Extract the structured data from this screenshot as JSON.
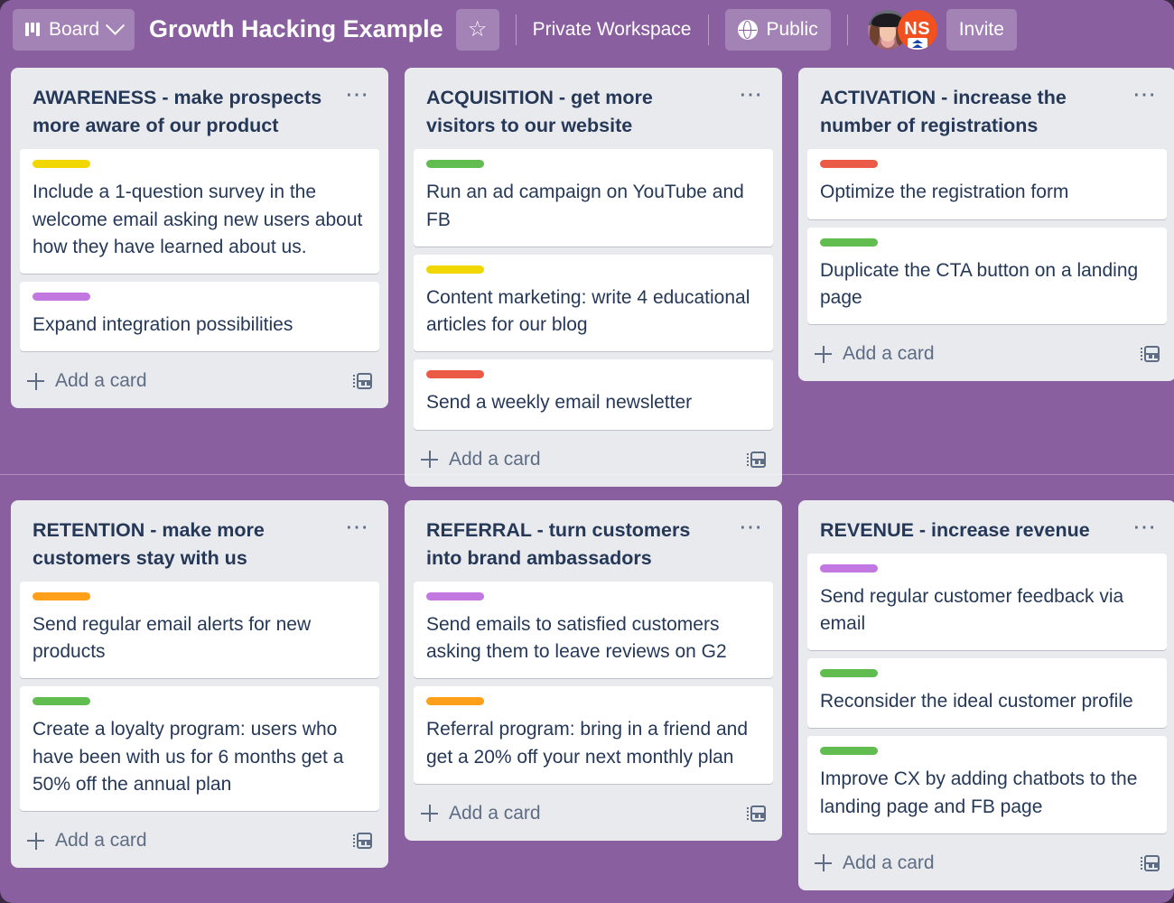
{
  "header": {
    "view_button_label": "Board",
    "view_icon": "board-icon",
    "chevron_icon": "chevron-down-icon",
    "board_title": "Growth Hacking Example",
    "star_icon": "star-icon",
    "workspace_label": "Private Workspace",
    "visibility_label": "Public",
    "visibility_icon": "globe-icon",
    "members": [
      {
        "type": "photo",
        "name": "member-avatar-photo"
      },
      {
        "type": "initials",
        "initials": "NS",
        "name": "member-avatar-initials"
      }
    ],
    "invite_label": "Invite"
  },
  "board": {
    "add_card_label": "Add a card",
    "card_template_icon": "card-template-icon",
    "list_menu_icon": "list-actions-icon",
    "label_colors": {
      "yellow": "#f2d600",
      "purple": "#c377e0",
      "green": "#61bd4f",
      "red": "#eb5a46",
      "orange": "#ff9f1a"
    },
    "rows": [
      {
        "lists": [
          {
            "title": "AWARENESS - make prospects more aware of our product",
            "cards": [
              {
                "label": "yellow",
                "title": "Include a 1-question survey in the welcome email asking new users about how they have learned about us."
              },
              {
                "label": "purple",
                "title": "Expand integration possibilities"
              }
            ]
          },
          {
            "title": "ACQUISITION - get more visitors to our website",
            "cards": [
              {
                "label": "green",
                "title": "Run an ad campaign on YouTube and FB"
              },
              {
                "label": "yellow",
                "title": "Content marketing: write 4 educational articles for our blog"
              },
              {
                "label": "red",
                "title": "Send a weekly email newsletter"
              }
            ]
          },
          {
            "title": "ACTIVATION - increase the number of registrations",
            "cards": [
              {
                "label": "red",
                "title": "Optimize the registration form"
              },
              {
                "label": "green",
                "title": "Duplicate the CTA button on a landing page"
              }
            ]
          }
        ]
      },
      {
        "lists": [
          {
            "title": "RETENTION - make more customers stay with us",
            "cards": [
              {
                "label": "orange",
                "title": "Send regular email alerts for new products"
              },
              {
                "label": "green",
                "title": "Create a loyalty program: users who have been with us for 6 months get a 50% off the annual plan"
              }
            ]
          },
          {
            "title": "REFERRAL - turn customers into brand ambassadors",
            "cards": [
              {
                "label": "purple",
                "title": "Send emails to satisfied customers asking them to leave reviews on G2"
              },
              {
                "label": "orange",
                "title": "Referral program: bring in a friend and get a 20% off your next monthly plan"
              }
            ]
          },
          {
            "title": "REVENUE - increase revenue",
            "cards": [
              {
                "label": "purple",
                "title": "Send regular customer feedback via email"
              },
              {
                "label": "green",
                "title": "Reconsider the ideal customer profile"
              },
              {
                "label": "green",
                "title": "Improve CX by adding chatbots to the landing page and FB page"
              }
            ]
          }
        ]
      }
    ]
  },
  "theme": {
    "background": "#8a5fa0",
    "list_background": "#e9eaee",
    "card_background": "#ffffff",
    "text_dark": "#253858",
    "text_muted": "#5e6c84"
  }
}
